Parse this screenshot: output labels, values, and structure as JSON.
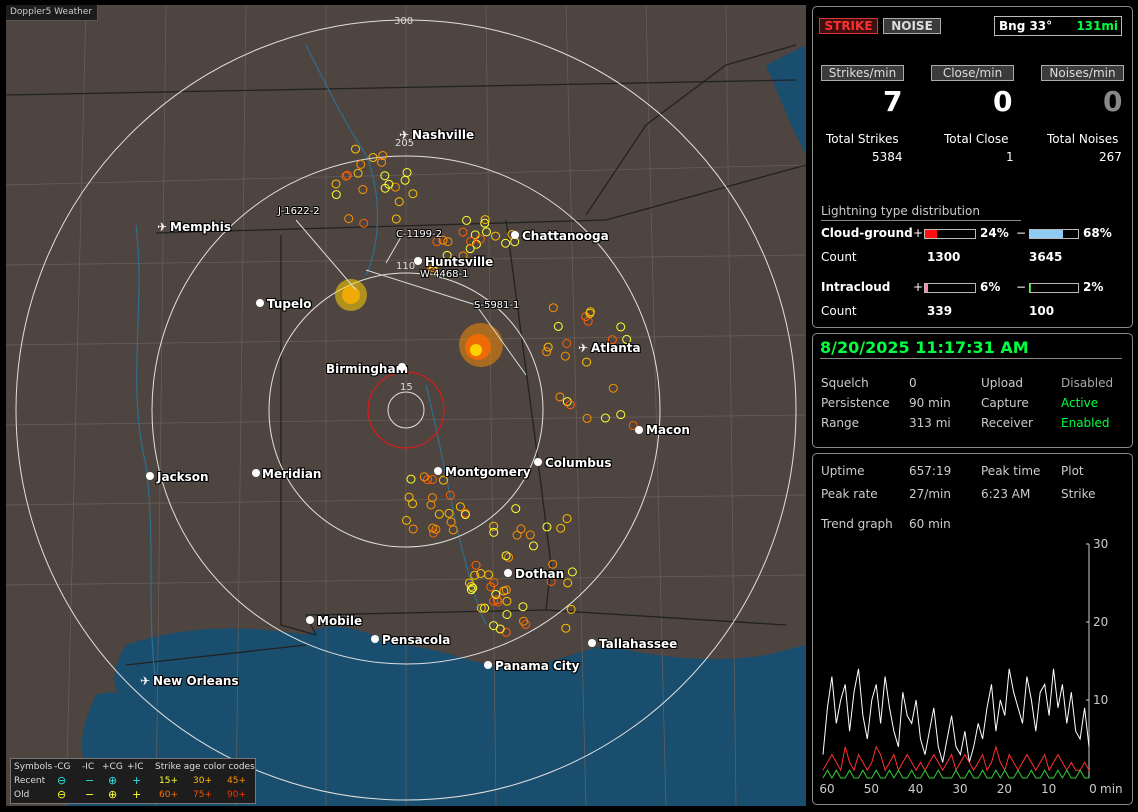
{
  "app_title": "Doppler5 Weather",
  "map": {
    "range_rings": [
      "300",
      "205",
      "110",
      "15"
    ],
    "cities": [
      {
        "name": "Nashville",
        "type": "airport"
      },
      {
        "name": "Memphis",
        "type": "airport"
      },
      {
        "name": "Chattanooga",
        "type": "city"
      },
      {
        "name": "Huntsville",
        "type": "city"
      },
      {
        "name": "Tupelo",
        "type": "city"
      },
      {
        "name": "Atlanta",
        "type": "airport"
      },
      {
        "name": "Birmingham",
        "type": "city"
      },
      {
        "name": "Macon",
        "type": "city"
      },
      {
        "name": "Jackson",
        "type": "airport"
      },
      {
        "name": "Meridian",
        "type": "city"
      },
      {
        "name": "Montgomery",
        "type": "city"
      },
      {
        "name": "Columbus",
        "type": "city"
      },
      {
        "name": "Dothan",
        "type": "city"
      },
      {
        "name": "Mobile",
        "type": "city"
      },
      {
        "name": "Pensacola",
        "type": "city"
      },
      {
        "name": "Tallahassee",
        "type": "city"
      },
      {
        "name": "Panama City",
        "type": "city"
      },
      {
        "name": "New Orleans",
        "type": "airport"
      }
    ],
    "storm_labels": [
      "J-1622-2",
      "C-1199-2",
      "W-4468-1",
      "S-5981-1"
    ]
  },
  "legend": {
    "symbols_label": "Symbols",
    "recent_label": "Recent",
    "old_label": "Old",
    "cols": [
      "-CG",
      "-IC",
      "+CG",
      "+IC"
    ],
    "age_label": "Strike age color codes",
    "recent_ages": [
      "15+",
      "30+",
      "45+"
    ],
    "old_ages": [
      "60+",
      "75+",
      "90+"
    ]
  },
  "top": {
    "strike_btn": "STRIKE",
    "noise_btn": "NOISE",
    "bearing_label": "Bng 33°",
    "bearing_range": "131mi",
    "strikes_min_label": "Strikes/min",
    "close_min_label": "Close/min",
    "noises_min_label": "Noises/min",
    "strikes_min": "7",
    "close_min": "0",
    "noises_min": "0",
    "total_strikes_label": "Total Strikes",
    "total_close_label": "Total Close",
    "total_noises_label": "Total Noises",
    "total_strikes": "5384",
    "total_close": "1",
    "total_noises": "267",
    "dist_title": "Lightning type distribution",
    "cg_label": "Cloud-ground",
    "ic_label": "Intracloud",
    "count_label": "Count",
    "plus": "+",
    "minus": "−",
    "cg_pos_pct": "24%",
    "cg_neg_pct": "68%",
    "ic_pos_pct": "6%",
    "ic_neg_pct": "2%",
    "cg_pos_count": "1300",
    "cg_neg_count": "3645",
    "ic_pos_count": "339",
    "ic_neg_count": "100",
    "cg_pos_frac": 0.24,
    "cg_neg_frac": 0.68,
    "ic_pos_frac": 0.06,
    "ic_neg_frac": 0.02
  },
  "status": {
    "datetime": "8/20/2025 11:17:31 AM",
    "squelch_label": "Squelch",
    "squelch": "0",
    "upload_label": "Upload",
    "upload": "Disabled",
    "persistence_label": "Persistence",
    "persistence": "90 min",
    "capture_label": "Capture",
    "capture": "Active",
    "range_label": "Range",
    "range": "313 mi",
    "receiver_label": "Receiver",
    "receiver": "Enabled"
  },
  "stats": {
    "uptime_label": "Uptime",
    "uptime": "657:19",
    "peak_time_label": "Peak time",
    "peak_time": "6:23 AM",
    "plot_label": "Plot",
    "plot": "Strike",
    "peak_rate_label": "Peak rate",
    "peak_rate": "27/min",
    "trend_label": "Trend graph",
    "trend": "60 min"
  },
  "chart_data": {
    "type": "line",
    "x_ticks": [
      "60",
      "50",
      "40",
      "30",
      "20",
      "10",
      "0"
    ],
    "x_unit": "min",
    "y_ticks": [
      "30",
      "20",
      "10"
    ],
    "ylim": [
      0,
      30
    ],
    "series": [
      {
        "color": "#ffffff",
        "values": [
          3,
          9,
          13,
          7,
          10,
          12,
          6,
          11,
          14,
          8,
          5,
          10,
          12,
          7,
          13,
          9,
          6,
          4,
          11,
          8,
          7,
          10,
          5,
          3,
          6,
          9,
          4,
          2,
          5,
          8,
          4,
          3,
          6,
          2,
          4,
          7,
          5,
          9,
          12,
          6,
          10,
          8,
          14,
          11,
          9,
          7,
          13,
          10,
          6,
          11,
          12,
          8,
          14,
          9,
          12,
          7,
          11,
          6,
          5,
          9,
          4
        ]
      },
      {
        "color": "#ff3030",
        "values": [
          1,
          2,
          3,
          2,
          1,
          4,
          2,
          1,
          3,
          2,
          1,
          2,
          4,
          3,
          1,
          2,
          3,
          1,
          2,
          3,
          2,
          1,
          2,
          1,
          2,
          3,
          2,
          1,
          2,
          3,
          1,
          2,
          3,
          2,
          1,
          2,
          3,
          1,
          2,
          4,
          2,
          1,
          3,
          2,
          1,
          2,
          3,
          2,
          1,
          2,
          3,
          1,
          2,
          3,
          2,
          1,
          2,
          1,
          1,
          2,
          1
        ]
      },
      {
        "color": "#33cc33",
        "values": [
          0,
          1,
          0,
          1,
          0,
          0,
          1,
          0,
          0,
          1,
          0,
          0,
          1,
          0,
          0,
          1,
          0,
          1,
          0,
          0,
          1,
          0,
          0,
          1,
          0,
          0,
          1,
          0,
          0,
          0,
          1,
          0,
          0,
          1,
          0,
          0,
          1,
          0,
          0,
          1,
          0,
          1,
          0,
          0,
          1,
          0,
          0,
          1,
          0,
          0,
          1,
          0,
          0,
          1,
          0,
          1,
          0,
          0,
          1,
          0,
          0
        ]
      }
    ]
  },
  "colors": {
    "green": "#00ff40",
    "red_fill": "#ff1010",
    "blue_fill": "#8ecaf4",
    "pink_fill": "#ff7fbf"
  }
}
